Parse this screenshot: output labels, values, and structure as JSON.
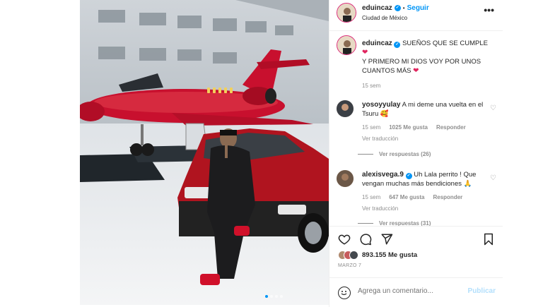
{
  "header": {
    "username": "eduincaz",
    "follow_label": "Seguir",
    "separator": "•",
    "location": "Ciudad de México",
    "more_label": "•••"
  },
  "caption": {
    "username": "eduincaz",
    "line1": "SUEÑOS QUE SE CUMPLE",
    "heart1": "❤",
    "line2": "Y PRIMERO MI DIOS VOY POR UNOS CUANTOS MÁS",
    "heart2": "❤",
    "time": "15 sem"
  },
  "comments": [
    {
      "username": "yosoyyulay",
      "text": "A mi deme una vuelta en el Tsuru",
      "emoji": "🥰",
      "time": "15 sem",
      "likes": "1025 Me gusta",
      "reply_label": "Responder",
      "translate_label": "Ver traducción",
      "replies_label": "Ver respuestas (26)"
    },
    {
      "username": "alexisvega.9",
      "text": "Uh Lala perrito ! Que vengan muchas más bendiciones",
      "emoji": "🙏",
      "time": "15 sem",
      "likes": "647 Me gusta",
      "reply_label": "Responder",
      "translate_label": "Ver traducción",
      "replies_label": "Ver respuestas (31)"
    }
  ],
  "actions": {
    "likes": "893.155 Me gusta",
    "date": "MARZO 7"
  },
  "comment_box": {
    "placeholder": "Agrega un comentario...",
    "publish_label": "Publicar"
  },
  "colors": {
    "accent": "#0095f6",
    "plane": "#c8102e",
    "car": "#b0141f",
    "heart": "#e0245e"
  },
  "carousel": {
    "slides": 4,
    "active_index": 0
  }
}
